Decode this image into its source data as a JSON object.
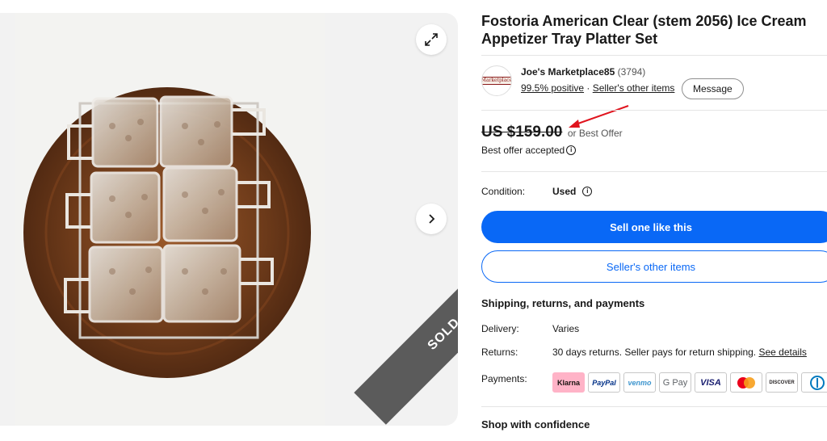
{
  "gallery": {
    "sold_label": "SOLD",
    "expand_icon": "expand-icon",
    "next_icon": "chevron-right-icon"
  },
  "item": {
    "title": "Fostoria American Clear (stem 2056) Ice Cream Appetizer Tray Platter Set"
  },
  "seller": {
    "logo_text": "Marketplace",
    "name": "Joe's Marketplace85",
    "feedback_count": "(3794)",
    "positive": "99.5% positive",
    "separator": "·",
    "other_items": "Seller's other items",
    "message_label": "Message"
  },
  "price": {
    "amount": "US $159.00",
    "offer_text": "or Best Offer",
    "accepted_text": "Best offer accepted"
  },
  "condition": {
    "label": "Condition:",
    "value": "Used"
  },
  "actions": {
    "sell_label": "Sell one like this",
    "other_items_label": "Seller's other items"
  },
  "shipping": {
    "heading": "Shipping, returns, and payments",
    "delivery_label": "Delivery:",
    "delivery_value": "Varies",
    "returns_label": "Returns:",
    "returns_value": "30 days returns. Seller pays for return shipping.",
    "returns_link": "See details",
    "payments_label": "Payments:",
    "payment_methods": [
      "Klarna",
      "PayPal",
      "venmo",
      "G Pay",
      "VISA",
      "",
      "DISCOVER",
      ""
    ]
  },
  "confidence": {
    "heading": "Shop with confidence"
  },
  "colors": {
    "primary_blue": "#0968f6",
    "sold_ribbon": "#5b5b5b",
    "annotation_arrow": "#e0141e"
  }
}
